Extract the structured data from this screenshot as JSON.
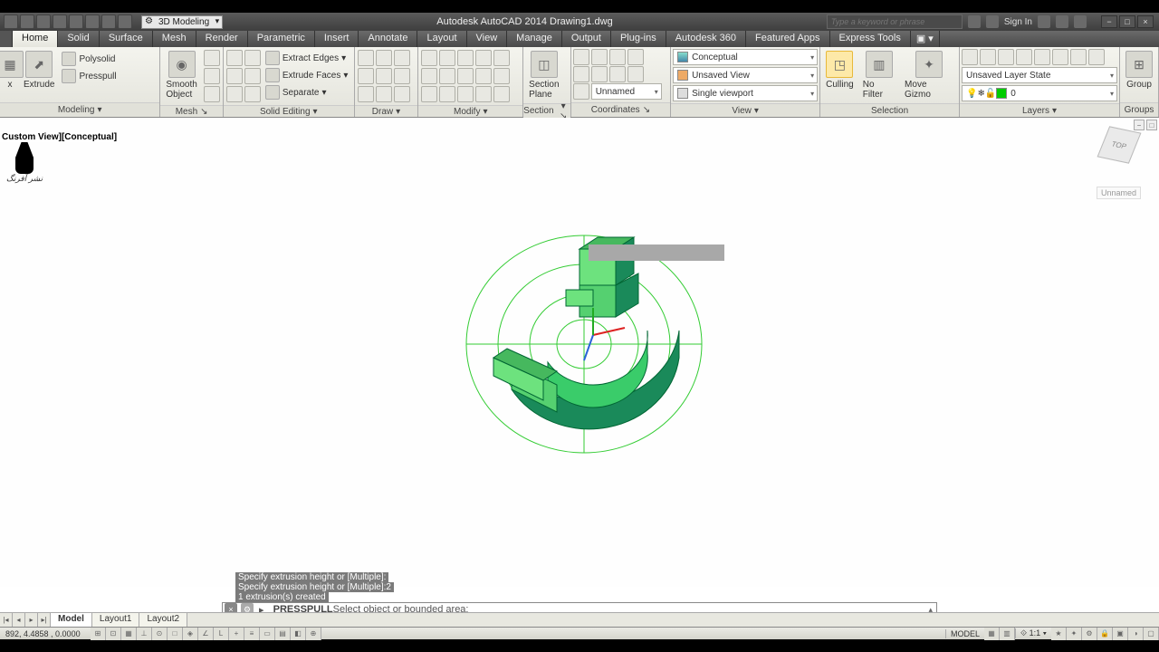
{
  "titlebar": {
    "workspace": "3D Modeling",
    "title": "Autodesk AutoCAD 2014    Drawing1.dwg",
    "search_placeholder": "Type a keyword or phrase",
    "signin": "Sign In"
  },
  "tabs": [
    "Home",
    "Solid",
    "Surface",
    "Mesh",
    "Render",
    "Parametric",
    "Insert",
    "Annotate",
    "Layout",
    "View",
    "Manage",
    "Output",
    "Plug-ins",
    "Autodesk 360",
    "Featured Apps",
    "Express Tools"
  ],
  "active_tab": "Home",
  "ribbon": {
    "modeling": {
      "title": "Modeling",
      "extrude": "Extrude",
      "polysolid": "Polysolid",
      "presspull": "Presspull",
      "smooth": "Smooth\nObject"
    },
    "mesh": {
      "title": "Mesh"
    },
    "solid_editing": {
      "title": "Solid Editing",
      "extract_edges": "Extract Edges",
      "extrude_faces": "Extrude Faces",
      "separate": "Separate"
    },
    "draw": {
      "title": "Draw"
    },
    "modify": {
      "title": "Modify"
    },
    "section": {
      "title": "Section",
      "plane": "Section\nPlane"
    },
    "coordinates": {
      "title": "Coordinates",
      "unnamed": "Unnamed"
    },
    "view": {
      "title": "View",
      "style": "Conceptual",
      "unsaved": "Unsaved View",
      "viewport": "Single viewport"
    },
    "selection": {
      "title": "Selection",
      "culling": "Culling",
      "nofilter": "No Filter",
      "gizmo": "Move Gizmo"
    },
    "layers": {
      "title": "Layers",
      "state": "Unsaved Layer State",
      "layer0": "0"
    },
    "groups": {
      "title": "Groups",
      "group": "Group"
    }
  },
  "viewtag": "Custom View][Conceptual]",
  "viewcube": {
    "face": "TOP",
    "label": "Unnamed"
  },
  "cmd": {
    "hist": [
      "Specify extrusion height or [Multiple]:",
      "Specify extrusion height or [Multiple]:2",
      "1 extrusion(s) created"
    ],
    "prompt_cmd": "PRESSPULL",
    "prompt_txt": " Select object or bounded area:"
  },
  "layout": {
    "tabs": [
      "Model",
      "Layout1",
      "Layout2"
    ],
    "active": "Model"
  },
  "status": {
    "coords": "892, 4.4858 , 0.0000",
    "model": "MODEL",
    "scale": "1:1"
  }
}
